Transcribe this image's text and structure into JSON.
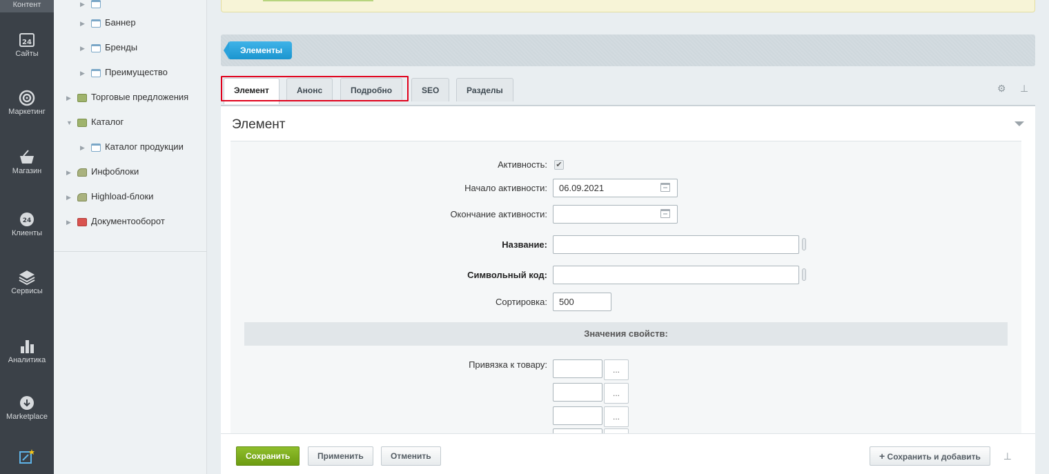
{
  "leftbar": {
    "items": [
      {
        "label": "Контент",
        "icon": "content-icon"
      },
      {
        "label": "Сайты",
        "icon": "calendar-24-icon"
      },
      {
        "label": "Маркетинг",
        "icon": "target-icon"
      },
      {
        "label": "Магазин",
        "icon": "basket-icon"
      },
      {
        "label": "Клиенты",
        "icon": "clients-24-icon"
      },
      {
        "label": "Сервисы",
        "icon": "layers-icon"
      },
      {
        "label": "Аналитика",
        "icon": "bar-chart-icon"
      },
      {
        "label": "Marketplace",
        "icon": "cloud-download-icon"
      }
    ]
  },
  "tree": {
    "items": [
      {
        "label": "Баннер"
      },
      {
        "label": "Бренды"
      },
      {
        "label": "Преимущество"
      },
      {
        "label": "Торговые предложения"
      },
      {
        "label": "Каталог"
      },
      {
        "label": "Каталог продукции"
      },
      {
        "label": "Инфоблоки"
      },
      {
        "label": "Highload-блоки"
      },
      {
        "label": "Документооборот"
      }
    ]
  },
  "toolbar": {
    "elements_label": "Элементы"
  },
  "tabs": [
    {
      "label": "Элемент"
    },
    {
      "label": "Анонс"
    },
    {
      "label": "Подробно"
    },
    {
      "label": "SEO"
    },
    {
      "label": "Разделы"
    }
  ],
  "panel": {
    "title": "Элемент"
  },
  "form": {
    "active_label": "Активность:",
    "start_label": "Начало активности:",
    "start_value": "06.09.2021",
    "end_label": "Окончание активности:",
    "end_value": "",
    "name_label": "Название:",
    "name_value": "",
    "code_label": "Символьный код:",
    "code_value": "",
    "sort_label": "Сортировка:",
    "sort_value": "500",
    "props_header": "Значения свойств:",
    "link_label": "Привязка к товару:",
    "pick_label": "..."
  },
  "bottom": {
    "save": "Сохранить",
    "apply": "Применить",
    "cancel": "Отменить",
    "save_add": "Сохранить и добавить"
  },
  "colors": {
    "accent_blue": "#1b95cf",
    "save_green": "#6d9c12",
    "highlight_red": "#e0001b"
  }
}
